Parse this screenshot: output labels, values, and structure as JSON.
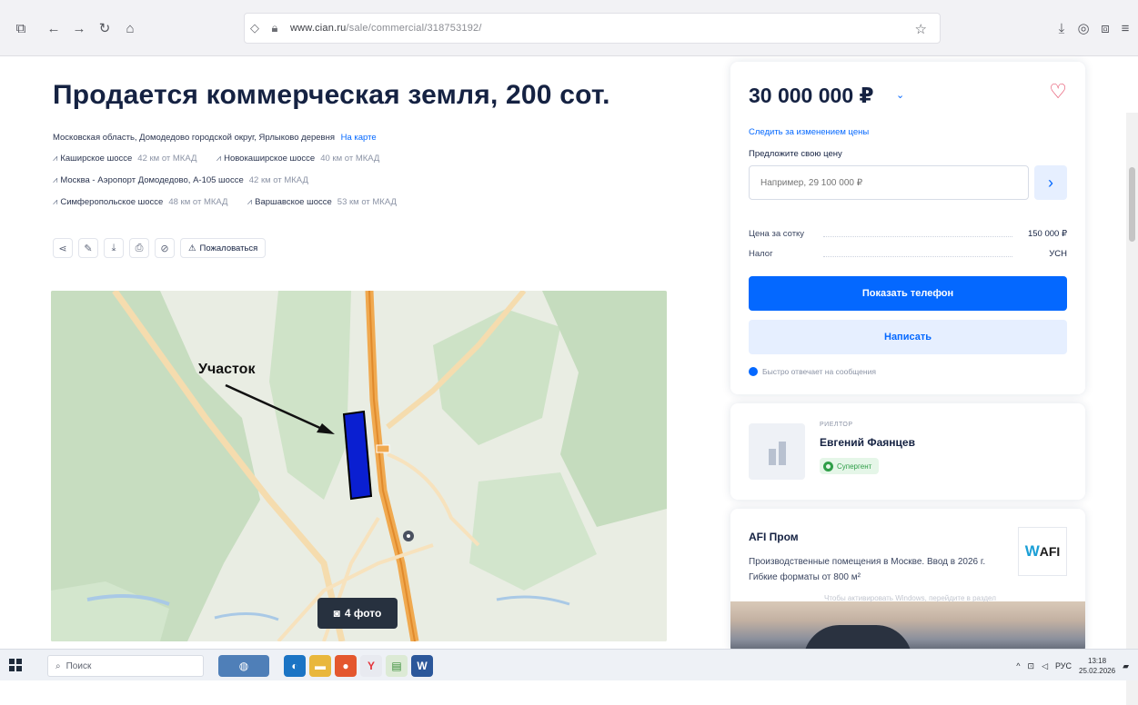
{
  "browser": {
    "url_domain": "www.cian.ru",
    "url_path": "/sale/commercial/318753192/",
    "icons": [
      "tabs-icon",
      "back-icon",
      "forward-icon",
      "reload-icon",
      "home-icon",
      "shield-icon",
      "lock-icon",
      "star-icon",
      "download-icon",
      "account-icon",
      "extensions-icon",
      "menu-icon"
    ]
  },
  "listing": {
    "title": "Продается коммерческая земля, 200 сот.",
    "address": "Московская область, Домодедово городской округ, Ярлыково деревня",
    "on_map_link": "На карте",
    "highways": [
      [
        {
          "name": "Каширское шоссе",
          "dist": "42 км от МКАД"
        },
        {
          "name": "Новокаширское шоссе",
          "dist": "40 км от МКАД"
        }
      ],
      [
        {
          "name": "Москва - Аэропорт Домодедово, А-105 шоссе",
          "dist": "42 км от МКАД"
        }
      ],
      [
        {
          "name": "Симферопольское шоссе",
          "dist": "48 км от МКАД"
        },
        {
          "name": "Варшавское шоссе",
          "dist": "53 км от МКАД"
        }
      ]
    ],
    "complain_label": "Пожаловаться",
    "action_icons": [
      "share-icon",
      "edit-icon",
      "download-icon",
      "print-icon",
      "hide-icon"
    ]
  },
  "map": {
    "label": "Участок",
    "photo_button": "4 фото"
  },
  "price_card": {
    "price": "30 000 000 ₽",
    "follow_price": "Следить за изменением цены",
    "offer_label": "Предложите свою цену",
    "offer_placeholder": "Например, 29 100 000 ₽",
    "rows": [
      {
        "label": "Цена за сотку",
        "value": "150 000 ₽"
      },
      {
        "label": "Налог",
        "value": "УСН"
      }
    ],
    "show_phone": "Показать телефон",
    "write": "Написать",
    "fast_reply": "Быстро отвечает на сообщения"
  },
  "agent": {
    "role": "РИЕЛТОР",
    "name": "Евгений Фаянцев",
    "badge": "Супергент"
  },
  "ad": {
    "title": "AFI Пром",
    "text": "Производственные помещения в Москве. Ввод в 2026 г. Гибкие форматы от 800 м²",
    "logo": "AFI",
    "note": "Чтобы активировать Windows, перейдите в раздел"
  },
  "taskbar": {
    "search_label": "Поиск",
    "lang": "РУС",
    "time": "13:18",
    "date": "25.02.2026"
  },
  "colors": {
    "accent": "#0468ff",
    "heart": "#e23b5a",
    "plot": "#0a1fd1",
    "road": "#f0a94f"
  }
}
